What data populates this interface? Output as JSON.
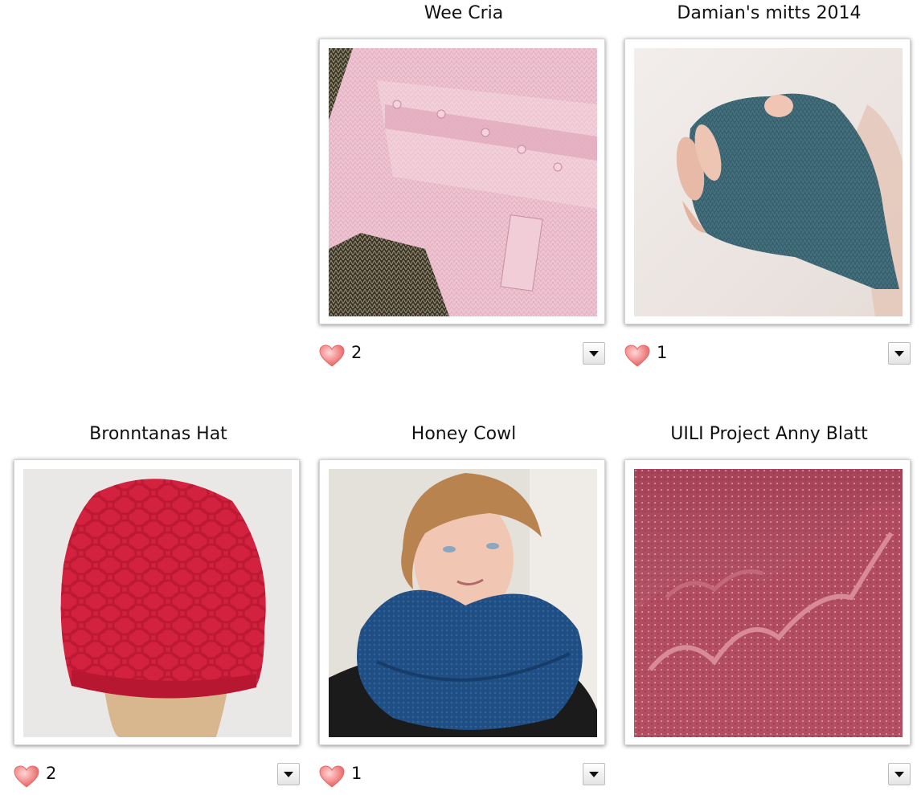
{
  "projects": [
    {
      "title": "Wee Cria",
      "likes": "2"
    },
    {
      "title": "Damian's mitts 2014",
      "likes": "1"
    },
    {
      "title": "Bronntanas Hat",
      "likes": "2"
    },
    {
      "title": "Honey Cowl",
      "likes": "1"
    },
    {
      "title": "UILI Project Anny Blatt",
      "likes": ""
    }
  ],
  "icons": {
    "like": "heart-icon",
    "menu": "chevron-down-icon"
  },
  "colors": {
    "heart": "#f28a8a"
  }
}
